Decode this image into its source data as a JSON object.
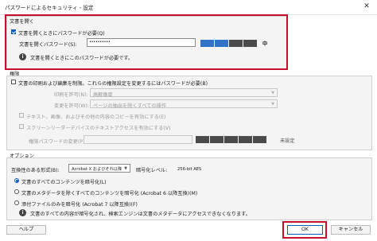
{
  "window": {
    "title": "パスワードによるセキュリティ - 設定"
  },
  "open_section": {
    "label": "文書を開く",
    "require_password_label": "文書を開くときにパスワードが必要(Q)",
    "require_password_checked": true,
    "password_field_label": "文書を開くパスワード(S):",
    "password_value": "••••••••••",
    "strength_label": "中",
    "strength_fill_fraction": 0.5,
    "strength_colors": {
      "filled": "#2f72c8",
      "empty": "#4a4a4a"
    },
    "info_text": "文書を開くときにこのパスワードが必要です。"
  },
  "permissions_section": {
    "label": "権限",
    "restrict_label": "文書の印刷および編集を制限。これらの権限設定を変更するにはパスワードが必要(B)",
    "restrict_checked": false,
    "print_allowed_label": "印刷を許可(N):",
    "print_allowed_value": "高解像度",
    "change_allowed_label": "変更を許可(W):",
    "change_allowed_value": "ページの抽出を除くすべての操作",
    "copy_label": "テキスト、画像、およびその他の内容のコピーを有効にする(E)",
    "screen_reader_label": "スクリーンリーダーデバイスのテキストアクセスを有効にする(V)",
    "perm_password_label": "権限パスワードの変更(P):",
    "perm_strength_label": "未設定"
  },
  "options_section": {
    "label": "オプション",
    "compat_label": "互換性のある形式(B):",
    "compat_value": "Acrobat X およびそれ以降",
    "encryption_level_label": "暗号化レベル:",
    "encryption_level_value": "256-bit AES",
    "radio_all": "文書のすべてのコンテンツを暗号化(L)",
    "radio_except_metadata": "文書のメタデータを除くすべてのコンテンツを暗号化 (Acrobat 6 以降互換)(M)",
    "radio_attachments": "添付ファイルのみを暗号化 (Acrobat 7 以降互換)(F)",
    "selected_radio": "all",
    "info_text": "文書のすべての内容が暗号化され、検索エンジンは文書のメタデータにアクセスできなくなります。"
  },
  "buttons": {
    "help": "ヘルプ",
    "ok": "OK",
    "cancel": "キャンセル"
  },
  "highlight_color": "#c8102e"
}
